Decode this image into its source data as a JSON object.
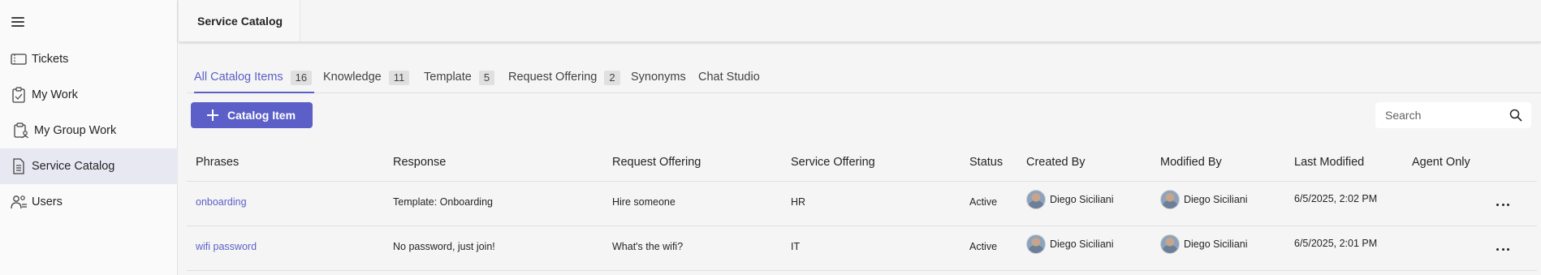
{
  "sidebar": {
    "items": [
      {
        "label": "Tickets",
        "icon": "ticket-icon"
      },
      {
        "label": "My Work",
        "icon": "clipboard-icon"
      },
      {
        "label": "My Group Work",
        "icon": "group-work-icon"
      },
      {
        "label": "Service Catalog",
        "icon": "document-icon"
      },
      {
        "label": "Users",
        "icon": "users-icon"
      }
    ],
    "active": "Service Catalog"
  },
  "header": {
    "title": "Service Catalog"
  },
  "tabs": [
    {
      "label": "All Catalog Items",
      "count": "16"
    },
    {
      "label": "Knowledge",
      "count": "11"
    },
    {
      "label": "Template",
      "count": "5"
    },
    {
      "label": "Request Offering",
      "count": "2"
    },
    {
      "label": "Synonyms"
    },
    {
      "label": "Chat Studio"
    }
  ],
  "toolbar": {
    "add_label": "Catalog Item",
    "search_placeholder": "Search"
  },
  "table": {
    "columns": [
      "Phrases",
      "Response",
      "Request Offering",
      "Service Offering",
      "Status",
      "Created By",
      "Modified By",
      "Last Modified",
      "Agent Only"
    ],
    "rows": [
      {
        "phrase": "onboarding",
        "response": "Template: Onboarding",
        "request_offering": "Hire someone",
        "service_offering": "HR",
        "status": "Active",
        "created_by": "Diego Siciliani",
        "modified_by": "Diego Siciliani",
        "last_modified": "6/5/2025, 2:02 PM",
        "agent_only": ""
      },
      {
        "phrase": "wifi password",
        "response": "No password, just join!",
        "request_offering": "What's the wifi?",
        "service_offering": "IT",
        "status": "Active",
        "created_by": "Diego Siciliani",
        "modified_by": "Diego Siciliani",
        "last_modified": "6/5/2025, 2:01 PM",
        "agent_only": ""
      }
    ]
  },
  "colors": {
    "accent": "#5b5fc7",
    "active_nav_bg": "#e8e8f3"
  }
}
